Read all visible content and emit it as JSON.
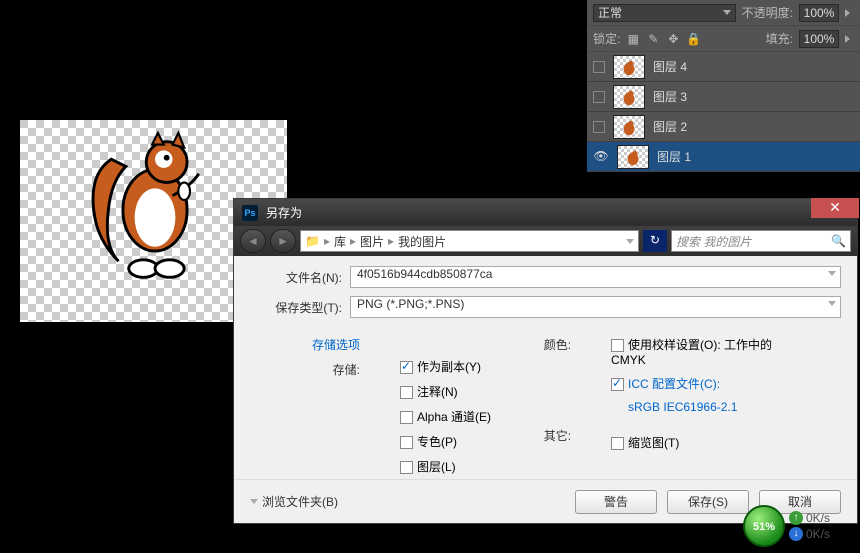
{
  "layers_panel": {
    "blend_mode": "正常",
    "opacity_label": "不透明度:",
    "opacity_value": "100%",
    "lock_label": "锁定:",
    "fill_label": "填充:",
    "fill_value": "100%",
    "layers": [
      {
        "name": "图层 4",
        "visible": false
      },
      {
        "name": "图层 3",
        "visible": false
      },
      {
        "name": "图层 2",
        "visible": false
      },
      {
        "name": "图层 1",
        "visible": true,
        "selected": true
      }
    ]
  },
  "dialog": {
    "title": "另存为",
    "breadcrumb": {
      "root": "库",
      "mid": "图片",
      "leaf": "我的图片"
    },
    "search_placeholder": "搜索 我的图片",
    "filename_label": "文件名(N):",
    "filename_value": "4f0516b944cdb850877ca",
    "type_label": "保存类型(T):",
    "type_value": "PNG (*.PNG;*.PNS)",
    "storage_options_title": "存储选项",
    "storage_label": "存储:",
    "opt_as_copy": "作为副本(Y)",
    "opt_annotations": "注释(N)",
    "opt_alpha": "Alpha 通道(E)",
    "opt_spot": "专色(P)",
    "opt_layers": "图层(L)",
    "color_label": "颜色:",
    "opt_proof": "使用校样设置(O): 工作中的 CMYK",
    "opt_icc": "ICC 配置文件(C):",
    "icc_profile": "sRGB IEC61966-2.1",
    "other_label": "其它:",
    "opt_thumb": "缩览图(T)",
    "browse_folders": "浏览文件夹(B)",
    "btn_warn": "警告",
    "btn_save": "保存(S)",
    "btn_cancel": "取消"
  },
  "download": {
    "percent": "51%",
    "up": "0K/s",
    "down": "0K/s"
  }
}
